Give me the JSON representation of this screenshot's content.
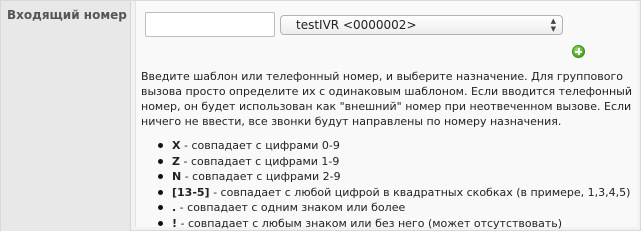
{
  "field": {
    "label": "Входящий номер"
  },
  "pattern_input": {
    "value": "",
    "placeholder": ""
  },
  "destination_select": {
    "selected": "testIVR <0000002>"
  },
  "add_button": {
    "icon": "plus-circle-icon",
    "color": "#47a71f"
  },
  "help": {
    "text": "Введите шаблон или телефонный номер, и выберите назначение. Для группового вызова просто определите их с одинаковым шаблоном. Если вводится телефонный номер, он будет использован как \"внешний\" номер при неотвеченном вызове. Если ничего не ввести, все звонки будут направлены по номеру назначения."
  },
  "rules": [
    {
      "token": "X",
      "desc": " - совпадает с цифрами 0-9"
    },
    {
      "token": "Z",
      "desc": " - совпадает с цифрами 1-9"
    },
    {
      "token": "N",
      "desc": " - совпадает с цифрами 2-9"
    },
    {
      "token": "[13-5]",
      "desc": " - совпадает с любой цифрой в квадратных скобках (в примере, 1,3,4,5)"
    },
    {
      "token": ".",
      "desc": " - совпадает с одним знаком или более"
    },
    {
      "token": "!",
      "desc": " - совпадает с любым знаком или без него (может отсутствовать)"
    }
  ]
}
